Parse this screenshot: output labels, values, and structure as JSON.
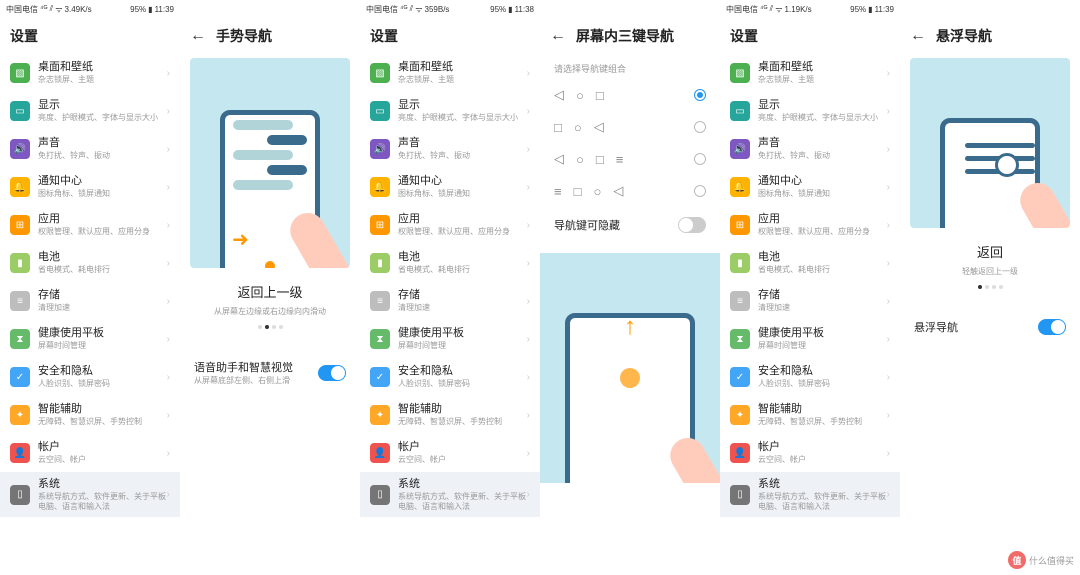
{
  "status": {
    "carrier": "中国电信",
    "signal": "⁴ᴳ ⫽",
    "wifi": "ᯤ",
    "speeds": [
      "3.49K/s",
      "359B/s",
      "1.19K/s"
    ],
    "battery": "95%",
    "times": [
      "11:39",
      "11:38",
      "11:39"
    ],
    "batt_icon": "▮"
  },
  "settings_header": "设置",
  "settings": [
    {
      "icon_cls": "ic-green",
      "glyph": "▧",
      "title": "桌面和壁纸",
      "sub": "杂志锁屏、主题"
    },
    {
      "icon_cls": "ic-teal",
      "glyph": "▭",
      "title": "显示",
      "sub": "亮度、护眼模式、字体与显示大小"
    },
    {
      "icon_cls": "ic-purple",
      "glyph": "🔊",
      "title": "声音",
      "sub": "免打扰、铃声、振动"
    },
    {
      "icon_cls": "ic-yellow",
      "glyph": "🔔",
      "title": "通知中心",
      "sub": "图标角标、锁屏通知"
    },
    {
      "icon_cls": "ic-orange",
      "glyph": "⊞",
      "title": "应用",
      "sub": "权限管理、默认应用、应用分身"
    },
    {
      "icon_cls": "ic-lime",
      "glyph": "▮",
      "title": "电池",
      "sub": "省电模式、耗电排行"
    },
    {
      "icon_cls": "ic-gray",
      "glyph": "≡",
      "title": "存储",
      "sub": "清理加速"
    },
    {
      "icon_cls": "ic-hgreen",
      "glyph": "⧗",
      "title": "健康使用平板",
      "sub": "屏幕时间管理"
    },
    {
      "icon_cls": "ic-blue",
      "glyph": "✓",
      "title": "安全和隐私",
      "sub": "人脸识别、锁屏密码"
    },
    {
      "icon_cls": "ic-orange2",
      "glyph": "✦",
      "title": "智能辅助",
      "sub": "无障碍、智慧识屏、手势控制"
    },
    {
      "icon_cls": "ic-red",
      "glyph": "👤",
      "title": "帐户",
      "sub": "云空间、帐户"
    },
    {
      "icon_cls": "ic-dgray",
      "glyph": "▯",
      "title": "系统",
      "sub": "系统导航方式、软件更新、关于平板电脑、语言和输入法"
    }
  ],
  "detail1": {
    "header": "手势导航",
    "title": "返回上一级",
    "sub": "从屏幕左边缘或右边缘向内滑动",
    "toggle_title": "语音助手和智慧视觉",
    "toggle_sub": "从屏幕底部左侧、右侧上滑"
  },
  "detail2": {
    "header": "屏幕内三键导航",
    "select_label": "请选择导航键组合",
    "options": [
      {
        "keys": [
          "◁",
          "○",
          "□"
        ],
        "selected": true
      },
      {
        "keys": [
          "□",
          "○",
          "◁"
        ],
        "selected": false
      },
      {
        "keys": [
          "◁",
          "○",
          "□",
          "≡"
        ],
        "selected": false
      },
      {
        "keys": [
          "≡",
          "□",
          "○",
          "◁"
        ],
        "selected": false
      }
    ],
    "hide_label": "导航键可隐藏"
  },
  "detail3": {
    "header": "悬浮导航",
    "title": "返回",
    "sub": "轻触返回上一级",
    "toggle_label": "悬浮导航"
  },
  "watermark": "什么值得买"
}
